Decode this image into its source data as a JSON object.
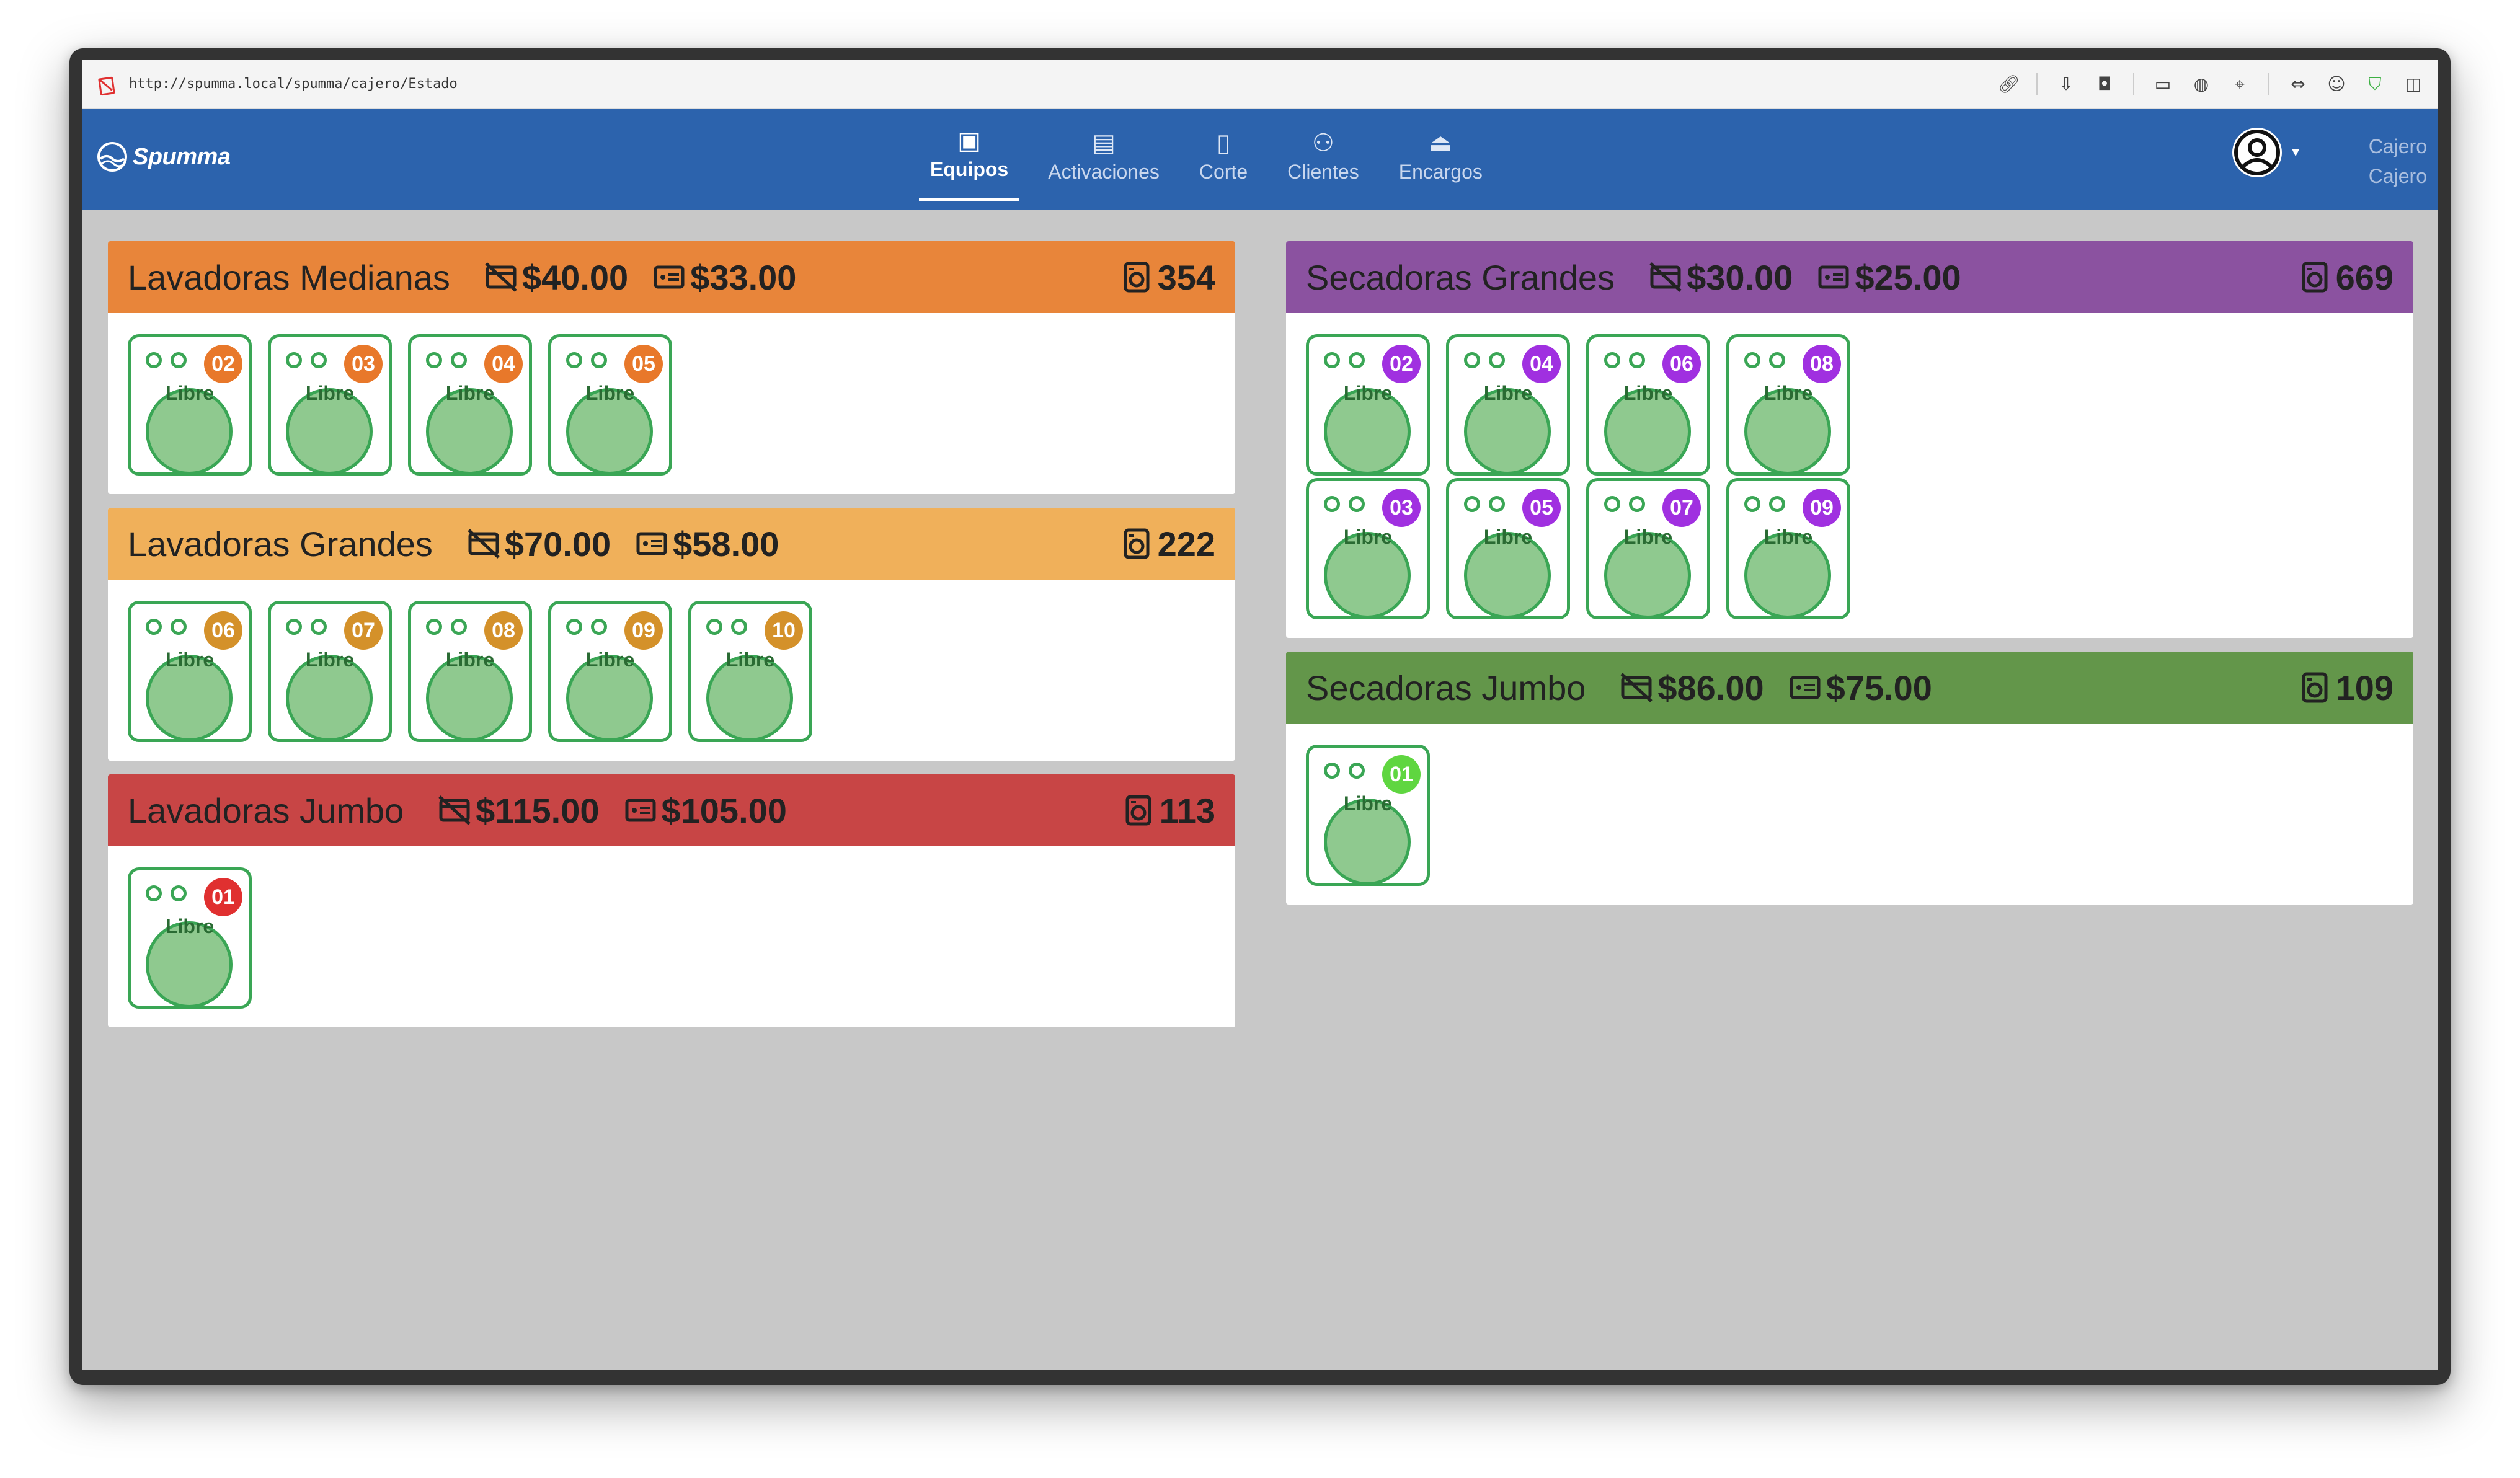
{
  "browser": {
    "url": "http://spumma.local/spumma/cajero/Estado",
    "icons": [
      "link-icon",
      "download-icon",
      "camera-icon",
      "terminal-icon",
      "globe-icon",
      "crosshair-icon",
      "code-icon",
      "face-icon",
      "shield-icon",
      "sidebar-icon"
    ]
  },
  "app": {
    "brand": "Spumma",
    "nav": [
      {
        "label": "Equipos",
        "icon": "washer-icon",
        "active": true
      },
      {
        "label": "Activaciones",
        "icon": "card-transfer-icon",
        "active": false
      },
      {
        "label": "Corte",
        "icon": "clipboard-icon",
        "active": false
      },
      {
        "label": "Clientes",
        "icon": "people-icon",
        "active": false
      },
      {
        "label": "Encargos",
        "icon": "hanger-icon",
        "active": false
      }
    ],
    "user": {
      "name": "Cajero",
      "role": "Cajero"
    }
  },
  "colors": {
    "navbar": "#2c63ad",
    "lavadoras_medianas": "#e8853a",
    "lavadoras_grandes": "#f0b05a",
    "lavadoras_jumbo": "#c84545",
    "secadoras_grandes": "#8b52a0",
    "secadoras_jumbo": "#63964a",
    "machine_border": "#3aa655",
    "drum_fill": "#8fc98f"
  },
  "groups": {
    "lavadoras_medianas": {
      "title": "Lavadoras Medianas",
      "price_normal": "$40.00",
      "price_card": "$33.00",
      "count": "354",
      "badge_color": "#e8782a",
      "machines": [
        {
          "num": "02",
          "status": "Libre"
        },
        {
          "num": "03",
          "status": "Libre"
        },
        {
          "num": "04",
          "status": "Libre"
        },
        {
          "num": "05",
          "status": "Libre"
        }
      ]
    },
    "lavadoras_grandes": {
      "title": "Lavadoras Grandes",
      "price_normal": "$70.00",
      "price_card": "$58.00",
      "count": "222",
      "badge_color": "#d4912a",
      "machines": [
        {
          "num": "06",
          "status": "Libre"
        },
        {
          "num": "07",
          "status": "Libre"
        },
        {
          "num": "08",
          "status": "Libre"
        },
        {
          "num": "09",
          "status": "Libre"
        },
        {
          "num": "10",
          "status": "Libre"
        }
      ]
    },
    "lavadoras_jumbo": {
      "title": "Lavadoras Jumbo",
      "price_normal": "$115.00",
      "price_card": "$105.00",
      "count": "113",
      "badge_color": "#e03030",
      "machines": [
        {
          "num": "01",
          "status": "Libre"
        }
      ]
    },
    "secadoras_grandes": {
      "title": "Secadoras Grandes",
      "price_normal": "$30.00",
      "price_card": "$25.00",
      "count": "669",
      "badge_color": "#a030e0",
      "machines": [
        {
          "num": "02",
          "status": "Libre"
        },
        {
          "num": "04",
          "status": "Libre"
        },
        {
          "num": "06",
          "status": "Libre"
        },
        {
          "num": "08",
          "status": "Libre"
        },
        {
          "num": "03",
          "status": "Libre"
        },
        {
          "num": "05",
          "status": "Libre"
        },
        {
          "num": "07",
          "status": "Libre"
        },
        {
          "num": "09",
          "status": "Libre"
        }
      ]
    },
    "secadoras_jumbo": {
      "title": "Secadoras Jumbo",
      "price_normal": "$86.00",
      "price_card": "$75.00",
      "count": "109",
      "badge_color": "#5fd640",
      "machines": [
        {
          "num": "01",
          "status": "Libre"
        }
      ]
    }
  }
}
